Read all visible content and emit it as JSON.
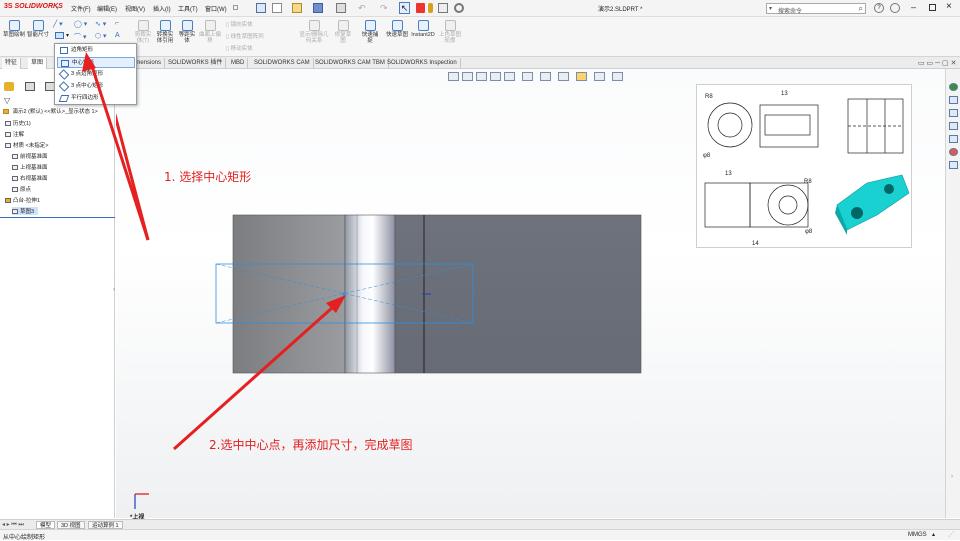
{
  "app": {
    "brand": "SOLIDWORKS",
    "brand_prefix": "3S",
    "doc_title": "演示2.SLDPRT *",
    "search_placeholder": "搜索命令"
  },
  "menu": [
    "文件(F)",
    "编辑(E)",
    "视图(V)",
    "插入(I)",
    "工具(T)",
    "窗口(W)"
  ],
  "ribbon": {
    "sketch_draw": "草图绘制",
    "smart_dim": "智能尺寸",
    "trim": "剪裁实体(T)",
    "convert": "转换实体引用",
    "offset": "等距实体",
    "offset_surface": "曲面上偏移",
    "mirror": "镜向实体",
    "linear_pattern": "线性草图阵列",
    "move": "移动实体",
    "show_relations": "显示/删除几何关系",
    "repair": "修复草图",
    "quick_snap": "快速捕捉",
    "rapid_sketch": "快速草图",
    "instant2d": "Instant2D",
    "shaded_sketch": "上色草图轮廓"
  },
  "tabs": [
    "特征",
    "草图",
    "imensions",
    "SOLIDWORKS 插件",
    "MBD",
    "SOLIDWORKS CAM",
    "SOLIDWORKS CAM TBM",
    "SOLIDWORKS Inspection"
  ],
  "dropdown": [
    "边角矩形",
    "中心矩形",
    "3 点边角矩形",
    "3 点中心矩形",
    "平行四边形"
  ],
  "tree": {
    "root": "演示2 (默认) <<默认>_显示状态 1>",
    "items": [
      "历史(1)",
      "注解",
      "材质 <未指定>",
      "前视基准面",
      "上视基准面",
      "右视基准面",
      "原点",
      "凸台-拉伸1",
      "草图3"
    ]
  },
  "annotations": {
    "step1": "1. 选择中心矩形",
    "step2": "2.选中中心点，再添加尺寸，完成草图"
  },
  "drawing": {
    "dims": [
      "R8",
      "13",
      "φ8",
      "13",
      "R8",
      "φ8",
      "14"
    ]
  },
  "triad": {
    "label": "*上视"
  },
  "bottom_tabs": [
    "模型",
    "3D 视图",
    "运动算例 1"
  ],
  "status": {
    "left": "从中心绘制矩形",
    "units": "MMGS"
  },
  "colors": {
    "accent": "#e52020",
    "selection": "#2f8fe0",
    "part": "#6a6f7a",
    "cyan": "#1ad1d1"
  }
}
